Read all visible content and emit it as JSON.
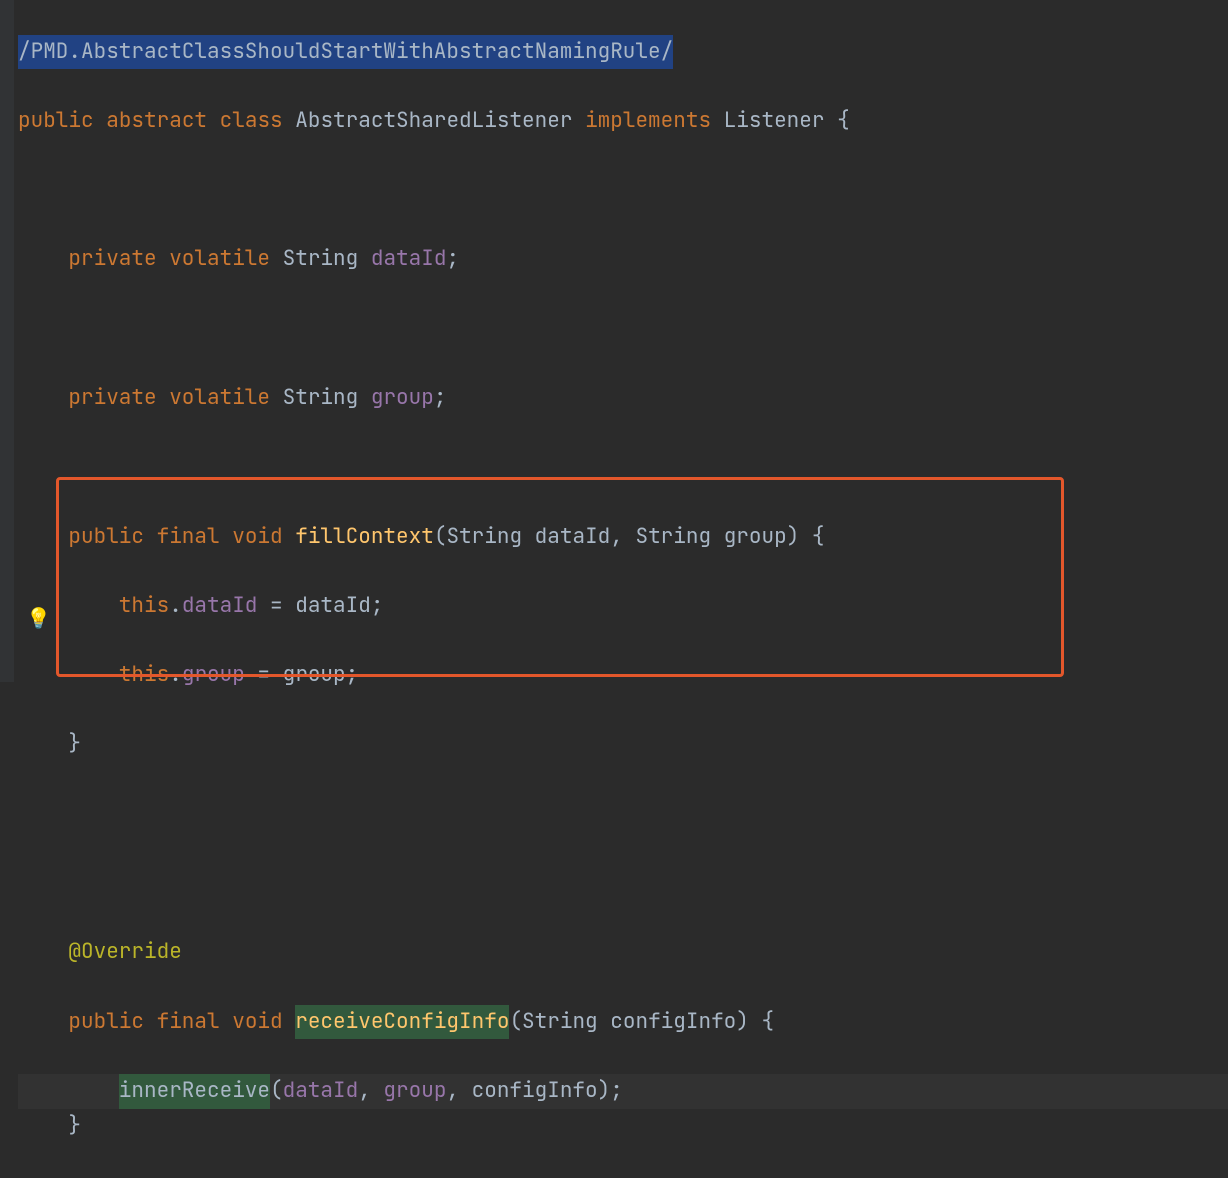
{
  "colors": {
    "background": "#2b2b2b",
    "keyword": "#cc7832",
    "type": "#a5c25c",
    "method": "#ffc66d",
    "field": "#9876aa",
    "annotation": "#bbb529",
    "selection": "#214283",
    "usage_highlight": "#32593d",
    "highlight_box": "#e3572b",
    "bulb": "#f0a732"
  },
  "intention_bulb": "💡",
  "suppression": {
    "comment": "/PMD.AbstractClassShouldStartWithAbstractNamingRule/"
  },
  "decl": {
    "public": "public",
    "abstract": "abstract",
    "class": "class",
    "name": "AbstractSharedListener",
    "implements": "implements",
    "iface": "Listener",
    "open": "{"
  },
  "field1": {
    "private": "private",
    "volatile": "volatile",
    "type": "String",
    "name": "dataId",
    "semi": ";"
  },
  "field2": {
    "private": "private",
    "volatile": "volatile",
    "type": "String",
    "name": "group",
    "semi": ";"
  },
  "method1": {
    "public": "public",
    "final": "final",
    "void": "void",
    "name": "fillContext",
    "p1t": "String",
    "p1n": "dataId",
    "p2t": "String",
    "p2n": "group",
    "open": "{",
    "body1_this": "this",
    "body1_dot": ".",
    "body1_f": "dataId",
    "body1_eq": " = ",
    "body1_v": "dataId",
    "body1_semi": ";",
    "body2_this": "this",
    "body2_dot": ".",
    "body2_f": "group",
    "body2_eq": " = ",
    "body2_v": "group",
    "body2_semi": ";",
    "close": "}"
  },
  "method2": {
    "anno": "@Override",
    "public": "public",
    "final": "final",
    "void": "void",
    "name": "receiveConfigInfo",
    "p1t": "String",
    "p1n": "configInfo",
    "open": "{",
    "call": "innerReceive",
    "a1": "dataId",
    "a2": "group",
    "a3": "configInfo",
    "semi": ";",
    "close": "}"
  }
}
